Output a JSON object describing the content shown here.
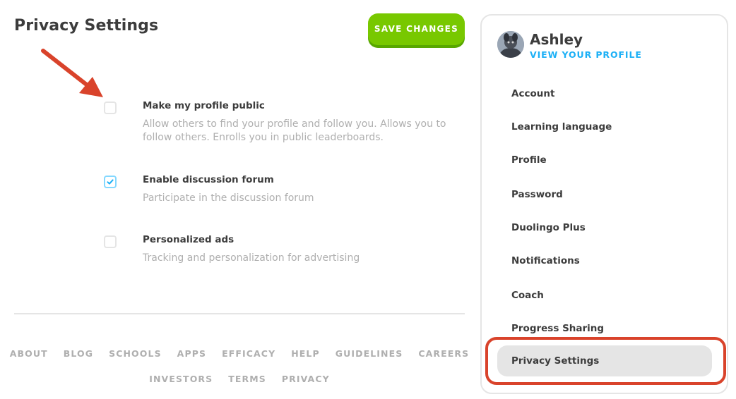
{
  "header": {
    "title": "Privacy Settings",
    "save_label": "SAVE CHANGES"
  },
  "settings": [
    {
      "label": "Make my profile public",
      "description": "Allow others to find your profile and follow you. Allows you to follow others. Enrolls you in public leaderboards.",
      "checked": false
    },
    {
      "label": "Enable discussion forum",
      "description": "Participate in the discussion forum",
      "checked": true
    },
    {
      "label": "Personalized ads",
      "description": "Tracking and personalization for advertising",
      "checked": false
    }
  ],
  "footer": {
    "row1": [
      "ABOUT",
      "BLOG",
      "SCHOOLS",
      "APPS",
      "EFFICACY",
      "HELP",
      "GUIDELINES",
      "CAREERS"
    ],
    "row2": [
      "INVESTORS",
      "TERMS",
      "PRIVACY"
    ]
  },
  "sidebar": {
    "user_name": "Ashley",
    "profile_link": "VIEW YOUR PROFILE",
    "items": [
      {
        "label": "Account",
        "active": false
      },
      {
        "label": "Learning language",
        "active": false
      },
      {
        "label": "Profile",
        "active": false
      },
      {
        "label": "Password",
        "active": false
      },
      {
        "label": "Duolingo Plus",
        "active": false
      },
      {
        "label": "Notifications",
        "active": false
      },
      {
        "label": "Coach",
        "active": false
      },
      {
        "label": "Progress Sharing",
        "active": false
      },
      {
        "label": "Privacy Settings",
        "active": true
      }
    ]
  },
  "colors": {
    "accent_green": "#78c800",
    "link_blue": "#1cb0f6",
    "annotation_red": "#d9432b"
  },
  "icons": {
    "avatar": "user-avatar-photo",
    "check": "check-icon",
    "annotation": "red-arrow-icon"
  }
}
